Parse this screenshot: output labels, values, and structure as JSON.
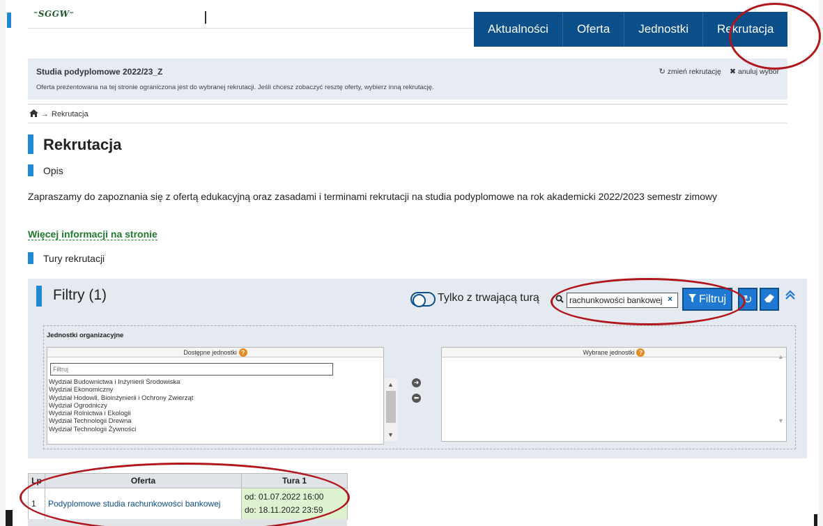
{
  "header": {
    "logo_text": "SGGW",
    "nav": [
      "Aktualności",
      "Oferta",
      "Jednostki",
      "Rekrutacja"
    ]
  },
  "recruitment": {
    "title": "Studia podyplomowe 2022/23_Z",
    "description": "Oferta prezentowana na tej stronie ograniczona jest do wybranej rekrutacji. Jeśli chcesz zobaczyć resztę oferty, wybierz inną rekrutację.",
    "change_label": "zmień rekrutację",
    "cancel_label": "anuluj wybór"
  },
  "breadcrumb": {
    "current": "Rekrutacja"
  },
  "page": {
    "title": "Rekrutacja",
    "section_opis": "Opis",
    "description": "Zapraszamy do zapoznania się z ofertą edukacyjną oraz zasadami i terminami rekrutacji na studia podyplomowe na rok akademicki 2022/2023 semestr zimowy",
    "more_info_link": "Więcej informacji na stronie",
    "section_tury": "Tury rekrutacji"
  },
  "filters": {
    "title": "Filtry (1)",
    "toggle_label": "Tylko z trwającą turą",
    "search_value": "rachunkowości bankowej",
    "filter_button": "Filtruj",
    "units_section_title": "Jednostki organizacyjne",
    "available_header": "Dostępne jednostki",
    "selected_header": "Wybrane jednostki",
    "filter_placeholder": "Filtruj",
    "available_units": [
      "Wydział Budownictwa i Inżynierii Środowiska",
      "Wydział Ekonomiczny",
      "Wydział Hodowli, Bioinżynierii i Ochrony Zwierząt",
      "Wydział Ogrodniczy",
      "Wydział Rolnictwa i Ekologii",
      "Wydział Technologii Drewna",
      "Wydział Technologii Żywności"
    ]
  },
  "results": {
    "headers": [
      "Lp",
      "Oferta",
      "Tura 1"
    ],
    "rows": [
      {
        "lp": "1",
        "offer": "Podyplomowe studia rachunkowości bankowej",
        "from": "od: 01.07.2022 16:00",
        "to": "do: 18.11.2022 23:59"
      }
    ]
  },
  "colors": {
    "nav_bg": "#0b4f8a",
    "accent_blue": "#1f8ad2",
    "link_green": "#1e7a2e",
    "annotation_red": "#b1161c",
    "tura_bg": "#ddf3cf"
  }
}
